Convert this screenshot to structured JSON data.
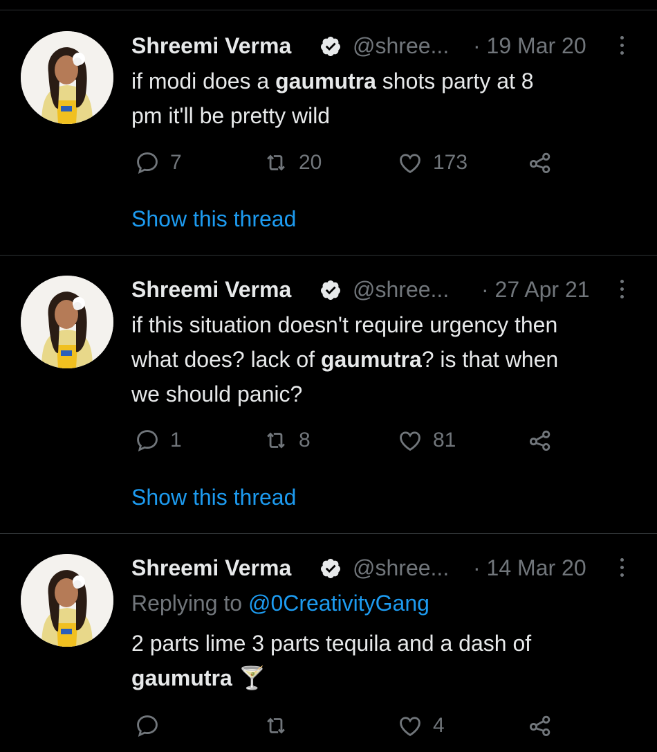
{
  "tweets": [
    {
      "name": "Shreemi Verma",
      "handle": "@shree...",
      "date": "· 19 Mar 20",
      "text_parts": [
        "if modi does a ",
        "gaumutra",
        " shots party at 8",
        "pm it'll be pretty wild"
      ],
      "replies": "7",
      "retweets": "20",
      "likes": "173",
      "thread_link": "Show this thread"
    },
    {
      "name": "Shreemi Verma",
      "handle": "@shree...",
      "date": "· 27 Apr 21",
      "text_parts": [
        "if this situation doesn't require urgency then",
        "what does? lack of ",
        "gaumutra",
        "? is that when",
        "we should panic?"
      ],
      "replies": "1",
      "retweets": "8",
      "likes": "81",
      "thread_link": "Show this thread"
    },
    {
      "name": "Shreemi Verma",
      "handle": "@shree...",
      "date": "· 14 Mar 20",
      "replying_prefix": "Replying to ",
      "replying_to": "@0CreativityGang",
      "text_parts": [
        "2 parts lime 3 parts tequila and a dash of",
        "gaumutra",
        " 🍸"
      ],
      "replies": "",
      "retweets": "",
      "likes": "4"
    }
  ],
  "colors": {
    "background": "#000000",
    "text": "#e7e9ea",
    "muted": "#71767b",
    "link": "#1d9bf0",
    "divider": "#2f3336"
  },
  "icons": [
    "verified-badge-icon",
    "more-icon",
    "reply-icon",
    "retweet-icon",
    "like-icon",
    "share-icon"
  ]
}
